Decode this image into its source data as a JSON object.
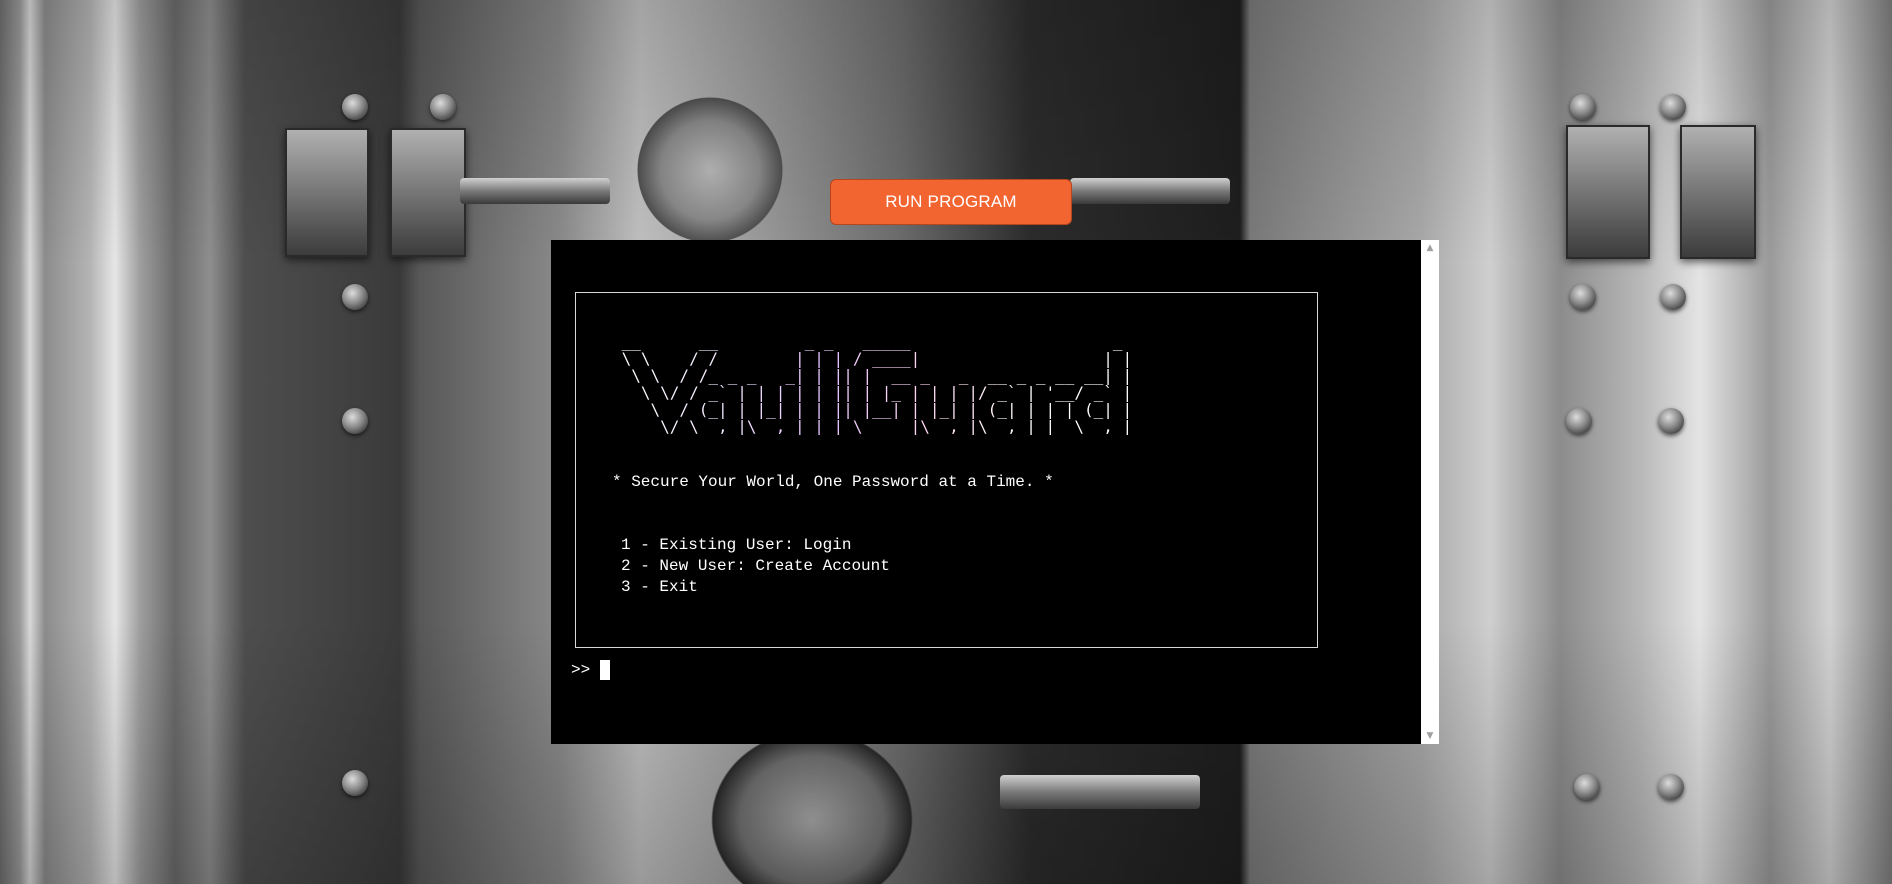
{
  "header": {
    "run_button_label": "RUN PROGRAM"
  },
  "terminal": {
    "logo_text": " __      __         _ _   _____                     _ \n \\ \\    / /        | | | / ____|                   | |\n  \\ \\  / /_ _ _   _| | || |  __ _   _  __ _ _ __ __| |\n   \\ \\/ / _` | | | | | || | |_ | | | |/ _` | '__/ _` |\n    \\  / (_| | |_| | | || |__| | |_| | (_| | | | (_| |\n     \\/ \\__,_|\\__,_|_|_| \\_____|\\__,_|\\__,_|_|  \\__,_|",
    "tagline": "* Secure Your World, One Password at a Time. *",
    "menu_items": [
      "1 - Existing User: Login",
      "2 - New User: Create Account",
      "3 - Exit"
    ],
    "prompt": ">>"
  },
  "colors": {
    "button_bg": "#f26430",
    "terminal_bg": "#000000",
    "terminal_text": "#ffffff"
  }
}
